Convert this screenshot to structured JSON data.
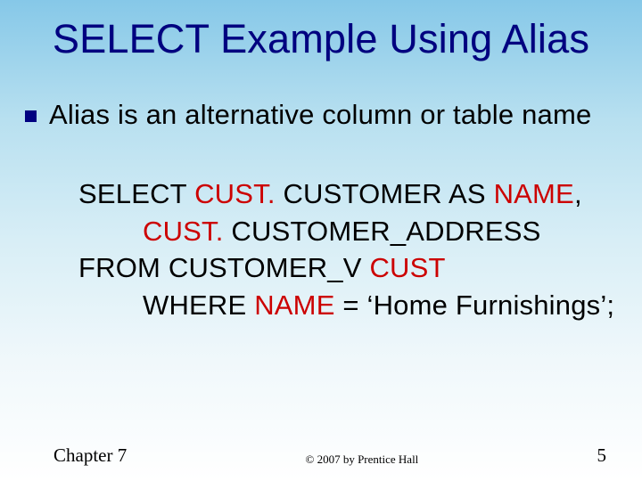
{
  "title": "SELECT Example Using Alias",
  "bullet": "Alias is an alternative column or table name",
  "code": {
    "l1a": "SELECT ",
    "l1b": "CUST.",
    "l1c": " CUSTOMER AS ",
    "l1d": "NAME",
    "l1e": ",",
    "l2a": "CUST.",
    "l2b": " CUSTOMER_ADDRESS",
    "l3a": "FROM CUSTOMER_V ",
    "l3b": "CUST",
    "l4a": "WHERE ",
    "l4b": "NAME",
    "l4c": " = ‘Home Furnishings’;"
  },
  "footer": {
    "chapter": "Chapter 7",
    "copyright": "© 2007 by Prentice Hall",
    "page": "5"
  }
}
